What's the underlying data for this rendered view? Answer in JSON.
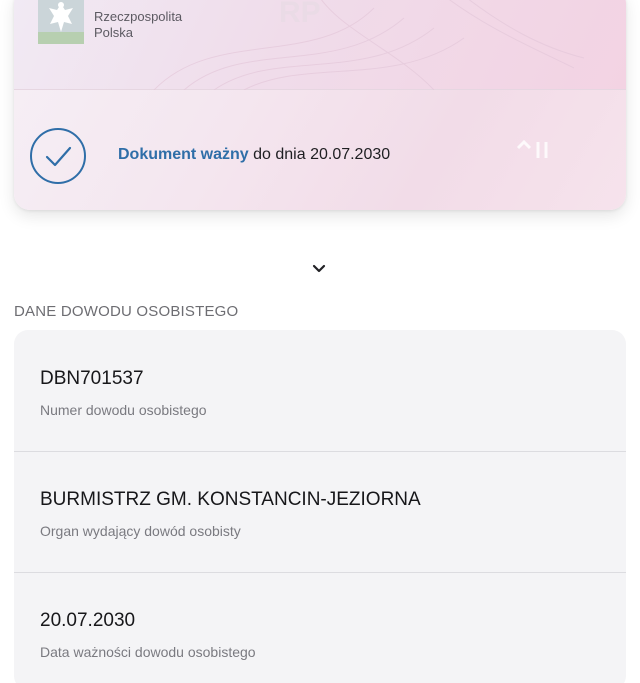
{
  "card": {
    "country_line1": "Rzeczpospolita",
    "country_line2": "Polska",
    "background_mark": "RP",
    "status_prefix": "Dokument ważny",
    "status_suffix": " do dnia 20.07.2030",
    "status_color": "#2f6ea8"
  },
  "section_title": "DANE DOWODU OSOBISTEGO",
  "details": [
    {
      "value": "DBN701537",
      "label": "Numer dowodu osobistego"
    },
    {
      "value": "BURMISTRZ GM. KONSTANCIN-JEZIORNA",
      "label": "Organ wydający dowód osobisty"
    },
    {
      "value": "20.07.2030",
      "label": "Data ważności dowodu osobistego"
    }
  ],
  "icons": {
    "emblem": "polish-eagle-emblem-icon",
    "status": "check-circle-icon",
    "expand": "chevron-down-icon"
  }
}
